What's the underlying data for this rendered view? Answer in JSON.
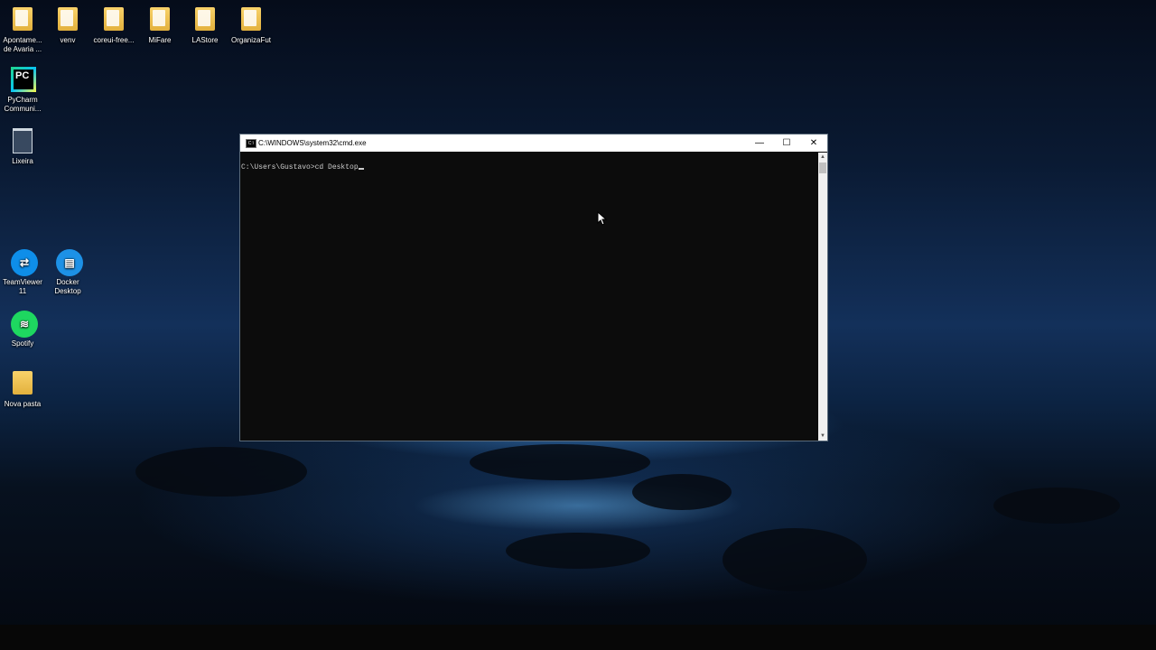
{
  "desktop": {
    "icons": [
      {
        "label": "Apontame... de Avaria ...",
        "icon": "folder-icon"
      },
      {
        "label": "venv",
        "icon": "folder-icon"
      },
      {
        "label": "coreui-free...",
        "icon": "folder-icon"
      },
      {
        "label": "MiFare",
        "icon": "folder-icon"
      },
      {
        "label": "LAStore",
        "icon": "folder-icon"
      },
      {
        "label": "OrganizaFut",
        "icon": "folder-icon"
      },
      {
        "label": "PyCharm Communi...",
        "icon": "pycharm-icon"
      },
      {
        "label": "Lixeira",
        "icon": "recycle-bin-icon"
      },
      {
        "label": "TeamViewer 11",
        "icon": "teamviewer-icon"
      },
      {
        "label": "Docker Desktop",
        "icon": "docker-icon"
      },
      {
        "label": "Spotify",
        "icon": "spotify-icon"
      },
      {
        "label": "Nova pasta",
        "icon": "folder-icon"
      }
    ]
  },
  "window": {
    "title": "C:\\WINDOWS\\system32\\cmd.exe",
    "minimize": "—",
    "maximize": "☐",
    "close": "✕",
    "console_line": "C:\\Users\\Gustavo>cd Desktop"
  },
  "colors": {
    "console_bg": "#0c0c0c",
    "console_text": "#cccccc",
    "titlebar": "#ffffff"
  }
}
